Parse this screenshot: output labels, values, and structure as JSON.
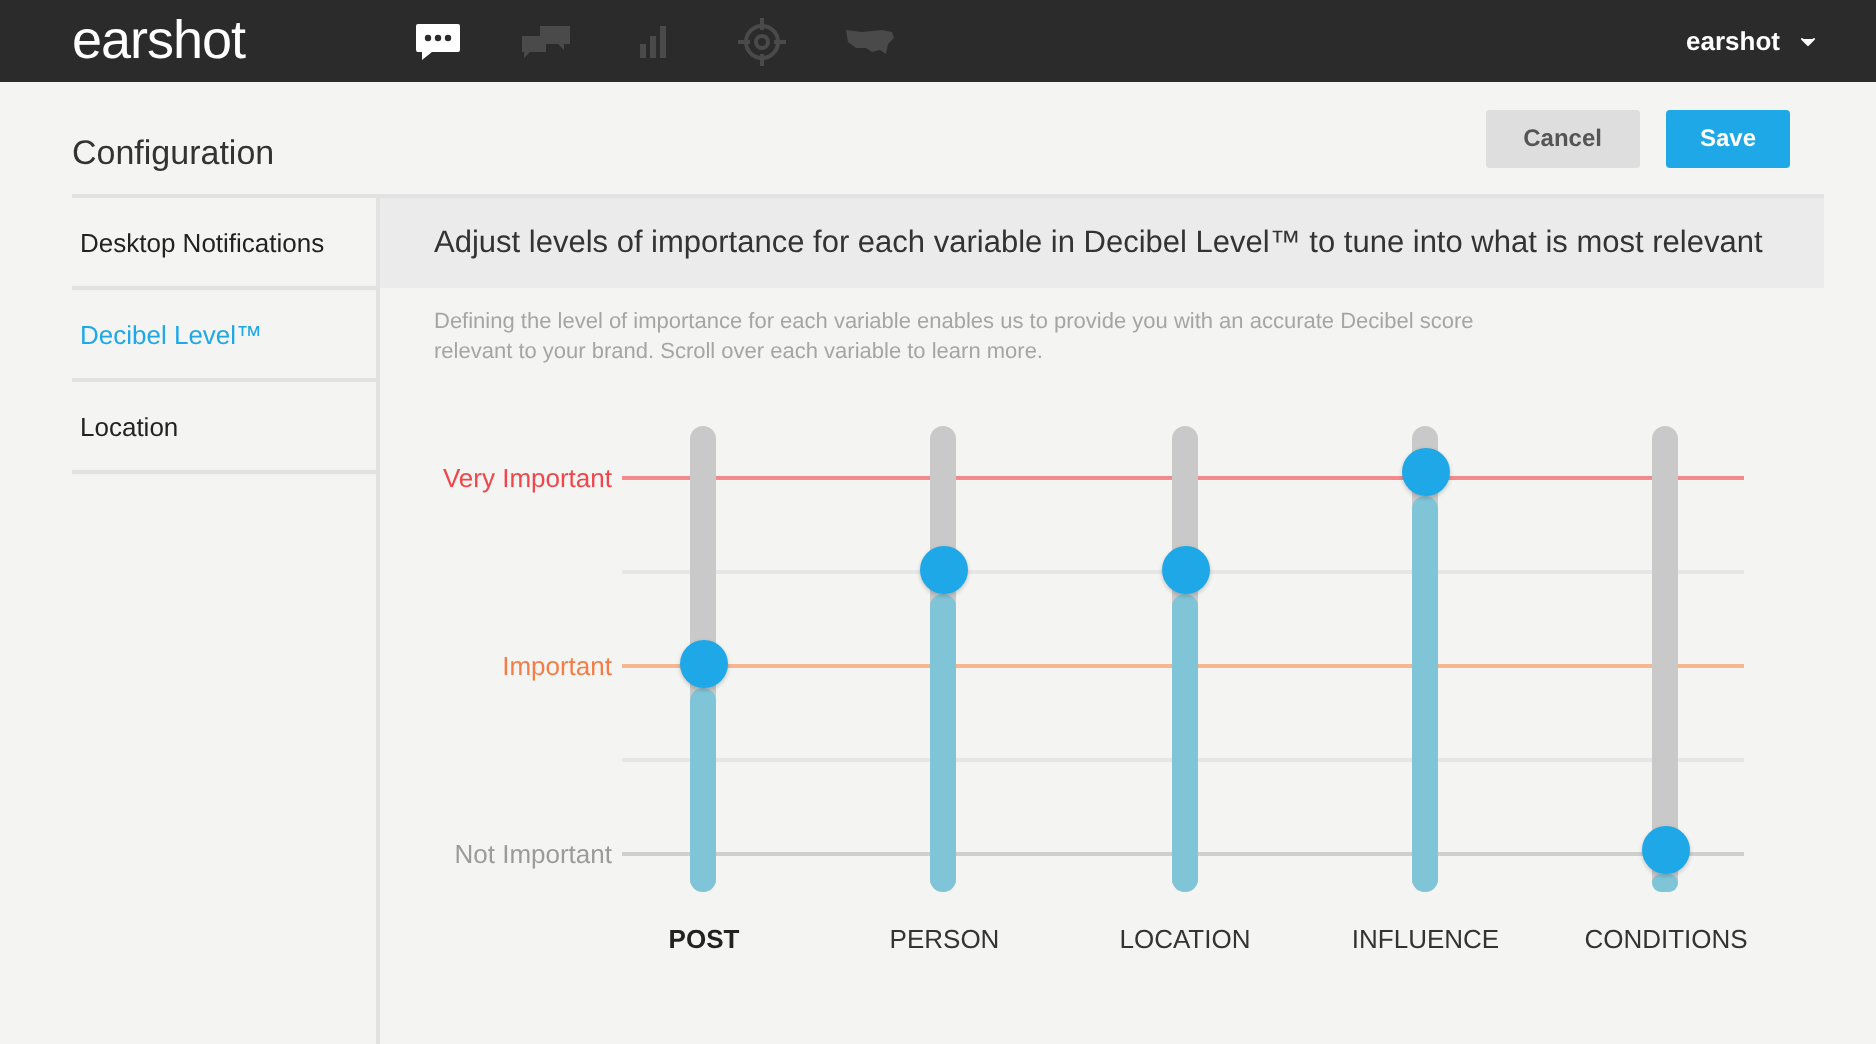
{
  "app": {
    "logo": "earshot",
    "user": "earshot"
  },
  "nav": [
    {
      "kind": "chat",
      "selected": true
    },
    {
      "kind": "conversation",
      "selected": false
    },
    {
      "kind": "chart",
      "selected": false
    },
    {
      "kind": "target",
      "selected": false
    },
    {
      "kind": "map",
      "selected": false
    }
  ],
  "page_title": "Configuration",
  "buttons": [
    {
      "label": "Cancel",
      "kind": "secondary"
    },
    {
      "label": "Save",
      "kind": "primary"
    }
  ],
  "sidebar": {
    "items": [
      {
        "label": "Desktop Notifications",
        "selected": false
      },
      {
        "label": "Decibel Level™",
        "selected": true
      },
      {
        "label": "Location",
        "selected": false
      }
    ]
  },
  "heading": "Adjust levels of importance for each variable in Decibel Level™ to tune into what is most relevant",
  "description": "Defining the level of importance for each variable enables us to provide you with an accurate Decibel score relevant to your brand. Scroll over each variable to learn more.",
  "importance_levels": [
    {
      "label": "Very Important",
      "color": "#f0454b"
    },
    {
      "label": "Important",
      "color": "#f47d45"
    },
    {
      "label": "Not Important",
      "color": "#9b9b9b"
    }
  ],
  "variables": [
    {
      "name": "POST",
      "level": 0.49,
      "selected": true
    },
    {
      "name": "PERSON",
      "level": 0.69,
      "selected": false
    },
    {
      "name": "LOCATION",
      "level": 0.69,
      "selected": false
    },
    {
      "name": "INFLUENCE",
      "level": 0.9,
      "selected": false
    },
    {
      "name": "CONDITIONS",
      "level": 0.09,
      "selected": false
    }
  ]
}
